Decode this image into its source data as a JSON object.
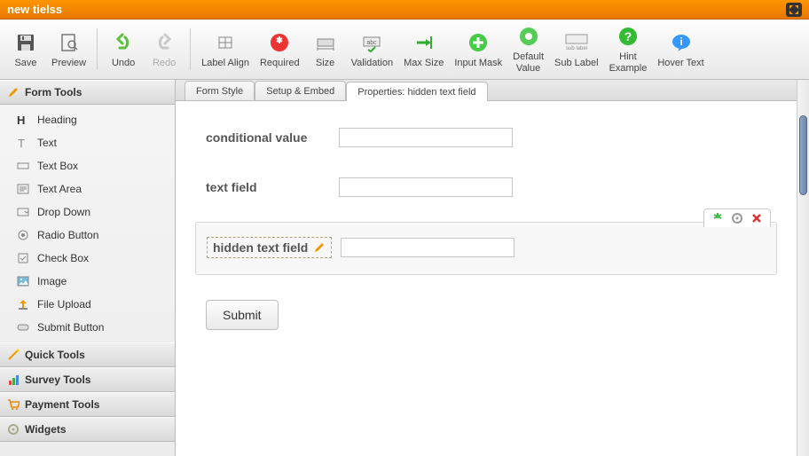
{
  "titlebar": {
    "title": "new tielss"
  },
  "toolbar": {
    "save": "Save",
    "preview": "Preview",
    "undo": "Undo",
    "redo": "Redo",
    "label_align": "Label Align",
    "required": "Required",
    "size": "Size",
    "validation": "Validation",
    "max_size": "Max Size",
    "input_mask": "Input Mask",
    "default_value": "Default\nValue",
    "sub_label": "Sub Label",
    "hint_example": "Hint\nExample",
    "hover_text": "Hover Text"
  },
  "sidebar": {
    "panels": {
      "form_tools": "Form Tools",
      "quick_tools": "Quick Tools",
      "survey_tools": "Survey Tools",
      "payment_tools": "Payment Tools",
      "widgets": "Widgets"
    },
    "form_tools_items": [
      {
        "label": "Heading"
      },
      {
        "label": "Text"
      },
      {
        "label": "Text Box"
      },
      {
        "label": "Text Area"
      },
      {
        "label": "Drop Down"
      },
      {
        "label": "Radio Button"
      },
      {
        "label": "Check Box"
      },
      {
        "label": "Image"
      },
      {
        "label": "File Upload"
      },
      {
        "label": "Submit Button"
      }
    ]
  },
  "tabs": {
    "form_style": "Form Style",
    "setup_embed": "Setup & Embed",
    "properties": "Properties: hidden text field"
  },
  "form": {
    "field1_label": "conditional value",
    "field2_label": "text field",
    "selected_label": "hidden text field",
    "submit_label": "Submit"
  }
}
